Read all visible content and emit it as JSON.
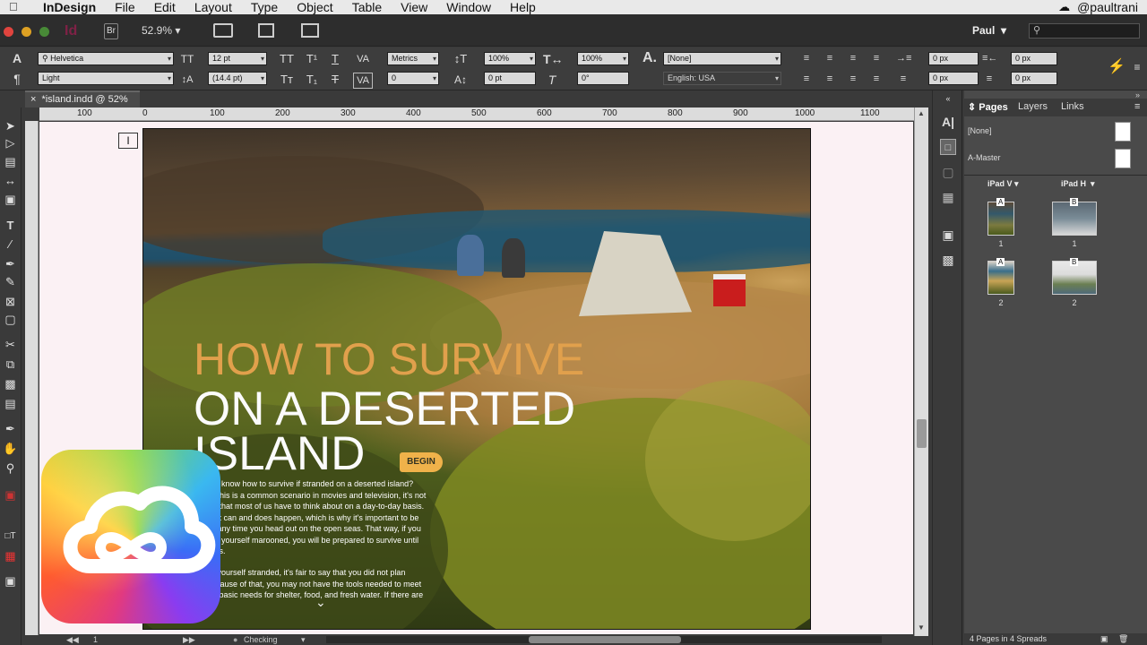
{
  "menubar": {
    "app_name": "InDesign",
    "items": [
      "File",
      "Edit",
      "Layout",
      "Type",
      "Object",
      "Table",
      "View",
      "Window",
      "Help"
    ],
    "user_handle": "@paultrani"
  },
  "appbar": {
    "br_label": "Br",
    "zoom": "52.9%",
    "user": "Paul"
  },
  "control": {
    "font_family": "Helvetica",
    "font_style": "Light",
    "font_size": "12 pt",
    "leading": "(14.4 pt)",
    "kerning": "Metrics",
    "tracking": "0",
    "vert_scale": "100%",
    "horiz_scale": "100%",
    "baseline_shift": "0 pt",
    "skew": "0°",
    "char_style": "[None]",
    "language": "English: USA",
    "indent_left": "0 px",
    "indent_right": "0 px",
    "indent_first": "0 px",
    "indent_last": "0 px"
  },
  "doc_tab": "*island.indd @ 52%",
  "ruler_labels": [
    "100",
    "0",
    "100",
    "200",
    "300",
    "400",
    "500",
    "600",
    "700",
    "800",
    "900",
    "1000",
    "1100"
  ],
  "document": {
    "headline_1": "HOW TO SURVIVE",
    "headline_2": "ON A DESERTED",
    "headline_3": "ISLAND",
    "begin_button": "BEGIN",
    "body_p1": [
      "you know how to survive if stranded on a deserted island?",
      "gh this is a common scenario in movies and television, it's not",
      "ing that most of us have to think about on a day-to-day basis.",
      "er, it can and does happen, which is why it's important to be",
      "ed any time you head out on the open seas. That way, if you",
      "find yourself marooned, you will be prepared to survive until",
      "rives."
    ],
    "body_p2": [
      "nd yourself stranded, it's fair to say that you did not plan",
      "Because of that, you may not have the tools needed to meet",
      "ost basic needs for shelter, food, and fresh water. If there are"
    ]
  },
  "status": {
    "page": "1",
    "preflight": "Checking"
  },
  "pages_panel": {
    "tabs": [
      "Pages",
      "Layers",
      "Links"
    ],
    "masters": [
      "[None]",
      "A-Master"
    ],
    "layout_v": "iPad V",
    "layout_h": "iPad H",
    "page_labels_v": [
      "1",
      "2"
    ],
    "page_labels_h": [
      "1",
      "2"
    ],
    "thumb_letters": [
      "A",
      "B",
      "A",
      "B"
    ],
    "footer": "4 Pages in 4 Spreads"
  },
  "colors": {
    "headline_orange": "#e1a04c",
    "begin_button": "#f0b24a",
    "pasteboard": "#fbf1f4"
  }
}
